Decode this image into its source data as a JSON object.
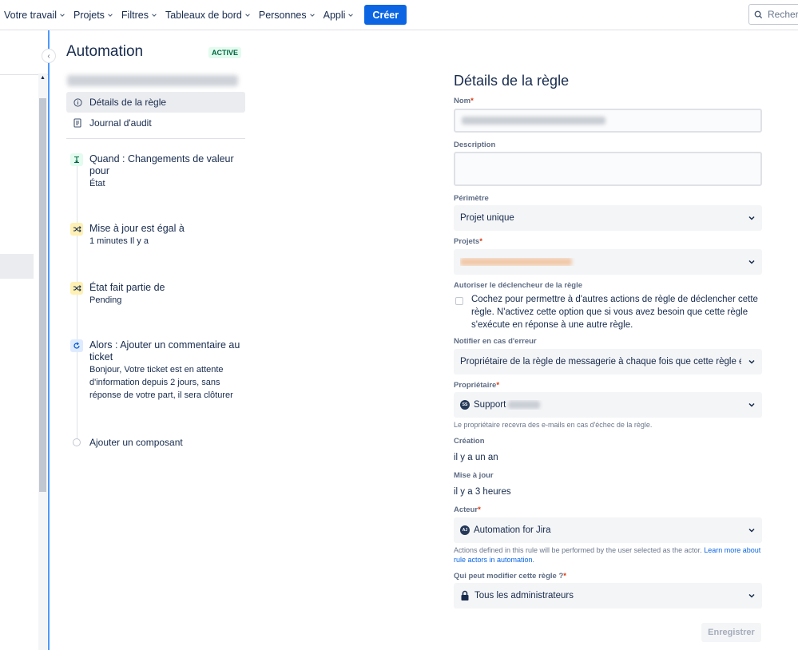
{
  "nav": {
    "items": [
      "Votre travail",
      "Projets",
      "Filtres",
      "Tableaux de bord",
      "Personnes",
      "Appli"
    ],
    "create_label": "Créer",
    "search_placeholder": "Recherc"
  },
  "automation": {
    "title": "Automation",
    "status_badge": "ACTIVE",
    "menu": [
      {
        "label": "Détails de la règle",
        "icon": "info-icon"
      },
      {
        "label": "Journal d'audit",
        "icon": "document-icon"
      }
    ],
    "components": [
      {
        "title": "Quand : Changements de valeur pour",
        "subtitle": "État",
        "icon": "trigger-icon",
        "color": "#e3fcef"
      },
      {
        "title": "Mise à jour est égal à",
        "subtitle": "1 minutes Il y a",
        "icon": "condition-icon",
        "color": "#fff0b3"
      },
      {
        "title": "État fait partie de",
        "subtitle": "Pending",
        "icon": "condition-icon",
        "color": "#fff0b3"
      },
      {
        "title": "Alors : Ajouter un commentaire au ticket",
        "subtitle": "Bonjour, Votre ticket est en attente d'information depuis 2 jours, sans réponse de votre part, il sera clôturer",
        "icon": "action-icon",
        "color": "#deebff"
      }
    ],
    "add_component": "Ajouter un composant"
  },
  "details": {
    "title": "Détails de la règle",
    "name_label": "Nom",
    "description_label": "Description",
    "scope_label": "Périmètre",
    "scope_value": "Projet unique",
    "projects_label": "Projets",
    "allow_trigger_label": "Autoriser le déclencheur de la règle",
    "allow_trigger_text": "Cochez pour permettre à d'autres actions de règle de déclencher cette règle. N'activez cette option que si vous avez besoin que cette règle s'exécute en réponse à une autre règle.",
    "notify_label": "Notifier en cas d'erreur",
    "notify_value": "Propriétaire de la règle de messagerie à chaque fois que cette règle é...",
    "owner_label": "Propriétaire",
    "owner_value": "Support",
    "owner_avatar": "SS",
    "owner_help": "Le propriétaire recevra des e-mails en cas d'échec de la règle.",
    "created_label": "Création",
    "created_value": "il y a un an",
    "updated_label": "Mise à jour",
    "updated_value": "il y a 3 heures",
    "actor_label": "Acteur",
    "actor_value": "Automation for Jira",
    "actor_avatar": "AJ",
    "actor_help": "Actions defined in this rule will be performed by the user selected as the actor.",
    "actor_help_link": "Learn more about rule actors in automation.",
    "who_label": "Qui peut modifier cette règle ?",
    "who_value": "Tous les administrateurs",
    "save_label": "Enregistrer",
    "required_mark": "*"
  }
}
